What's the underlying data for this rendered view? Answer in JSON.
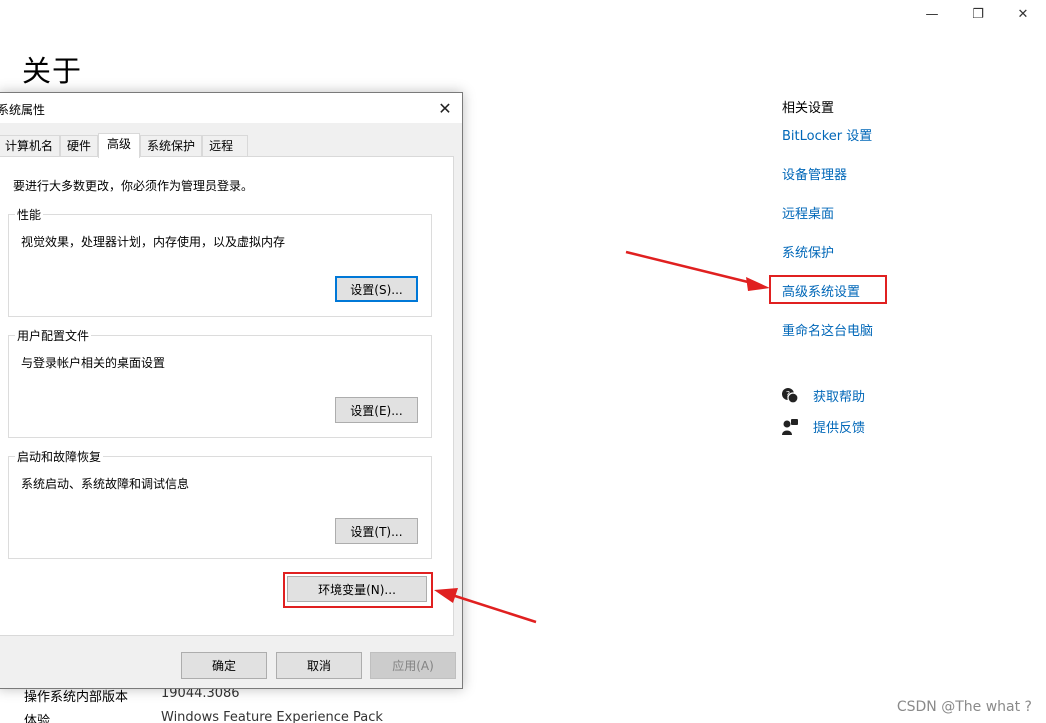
{
  "window": {
    "minimize_glyph": "—",
    "restore_glyph": "❐",
    "close_glyph": "✕",
    "page_title": "关于"
  },
  "related": {
    "heading": "相关设置",
    "links": [
      "BitLocker 设置",
      "设备管理器",
      "远程桌面",
      "系统保护",
      "高级系统设置",
      "重命名这台电脑"
    ]
  },
  "help": {
    "get_help": "获取帮助",
    "feedback": "提供反馈",
    "icons": [
      "chat-help-icon",
      "feedback-icon"
    ]
  },
  "specs": {
    "os_build_label": "操作系统内部版本",
    "os_build_value": "19044.3086",
    "experience_label": "体验",
    "experience_value": "Windows Feature Experience Pack"
  },
  "dialog": {
    "title": "系统属性",
    "close_glyph": "✕",
    "tabs": [
      "计算机名",
      "硬件",
      "高级",
      "系统保护",
      "远程"
    ],
    "active_tab": "高级",
    "notice": "要进行大多数更改，你必须作为管理员登录。",
    "performance": {
      "label": "性能",
      "desc": "视觉效果，处理器计划，内存使用，以及虚拟内存",
      "button": "设置(S)..."
    },
    "user_profiles": {
      "label": "用户配置文件",
      "desc": "与登录帐户相关的桌面设置",
      "button": "设置(E)..."
    },
    "startup_recovery": {
      "label": "启动和故障恢复",
      "desc": "系统启动、系统故障和调试信息",
      "button": "设置(T)..."
    },
    "env_button": "环境变量(N)...",
    "ok": "确定",
    "cancel": "取消",
    "apply": "应用(A)"
  },
  "watermark": "CSDN @The what ?",
  "colors": {
    "link": "#0067b8",
    "annotation_red": "#e02020",
    "focus_blue": "#0078d7"
  }
}
